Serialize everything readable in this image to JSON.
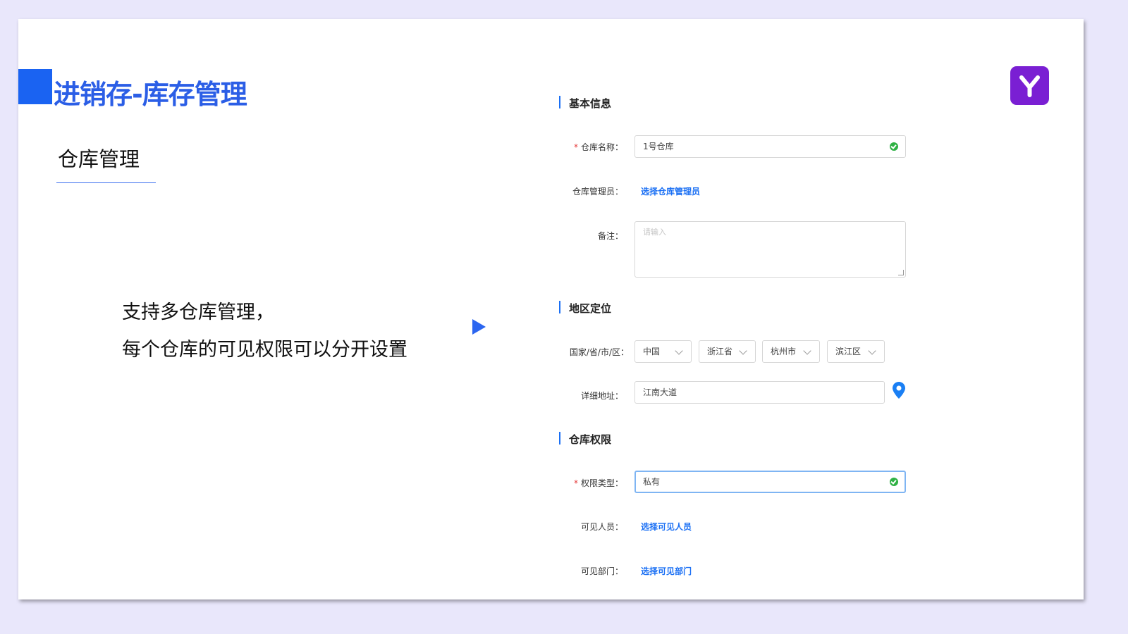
{
  "slide": {
    "title": "进销存-库存管理",
    "subtitle": "仓库管理",
    "description": [
      "支持多仓库管理，",
      "每个仓库的可见权限可以分开设置"
    ],
    "logo_icon": "brand-y-logo",
    "accent_color": "#1a63f2",
    "title_color": "#2b5ee6",
    "logo_color": "#7a1fd3"
  },
  "form": {
    "basic": {
      "section_title": "基本信息",
      "warehouse_name_label": "仓库名称：",
      "warehouse_name_value": "1号仓库",
      "manager_label": "仓库管理员：",
      "manager_link": "选择仓库管理员",
      "remark_label": "备注：",
      "remark_placeholder": "请输入"
    },
    "location": {
      "section_title": "地区定位",
      "region_label": "国家/省/市/区：",
      "country": "中国",
      "province": "浙江省",
      "city": "杭州市",
      "district": "滨江区",
      "address_label": "详细地址：",
      "address_value": "江南大道",
      "pin_icon": "location-pin-icon"
    },
    "permission": {
      "section_title": "仓库权限",
      "type_label": "权限类型：",
      "type_value": "私有",
      "visible_people_label": "可见人员：",
      "visible_people_link": "选择可见人员",
      "visible_dept_label": "可见部门：",
      "visible_dept_link": "选择可见部门"
    },
    "required_mark": "*",
    "valid_icon": "check-circle-icon",
    "link_color": "#1a6ff4"
  }
}
